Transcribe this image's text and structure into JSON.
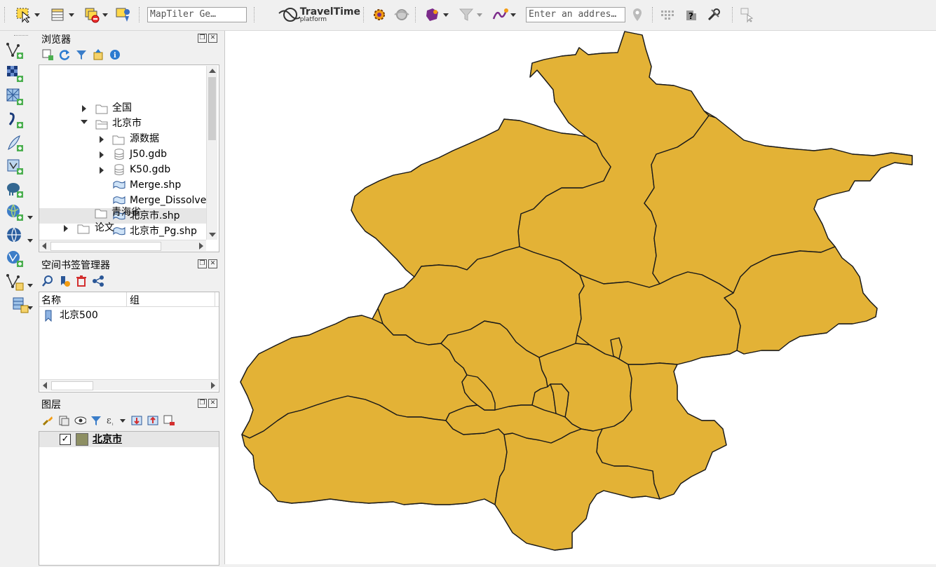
{
  "toolbar": {
    "mapiler_placeholder": "MapTiler Ge…",
    "traveltime_brand": "TravelTime",
    "traveltime_sub": "platform",
    "address_placeholder": "Enter an addres…"
  },
  "browser_panel": {
    "title": "浏览器",
    "items": [
      {
        "label": "全国",
        "type": "folder",
        "expander": "collapsed"
      },
      {
        "label": "北京市",
        "type": "folder-open",
        "expander": "expanded"
      },
      {
        "label": "源数据",
        "type": "folder",
        "expander": "collapsed"
      },
      {
        "label": "J50.gdb",
        "type": "database",
        "expander": "collapsed"
      },
      {
        "label": "K50.gdb",
        "type": "database",
        "expander": "collapsed"
      },
      {
        "label": "Merge.shp",
        "type": "polygon",
        "expander": "none"
      },
      {
        "label": "Merge_Dissolve",
        "type": "polygon",
        "expander": "none"
      },
      {
        "label": "北京市.shp",
        "type": "polygon",
        "expander": "none",
        "selected": true
      },
      {
        "label": "北京市_Pg.shp",
        "type": "polygon",
        "expander": "none"
      },
      {
        "label": "青海省",
        "type": "folder",
        "expander": "collapsed"
      },
      {
        "label": "论文",
        "type": "folder",
        "expander": "collapsed"
      }
    ]
  },
  "bookmarks_panel": {
    "title": "空间书签管理器",
    "columns": [
      "名称",
      "组"
    ],
    "rows": [
      {
        "name": "北京500"
      }
    ]
  },
  "layers_panel": {
    "title": "图层",
    "layers": [
      {
        "name": "北京市",
        "checked": true,
        "color": "#8d8f63"
      }
    ]
  },
  "map": {
    "fill_color": "#e3b236",
    "stroke_color": "#1a1a1a"
  }
}
